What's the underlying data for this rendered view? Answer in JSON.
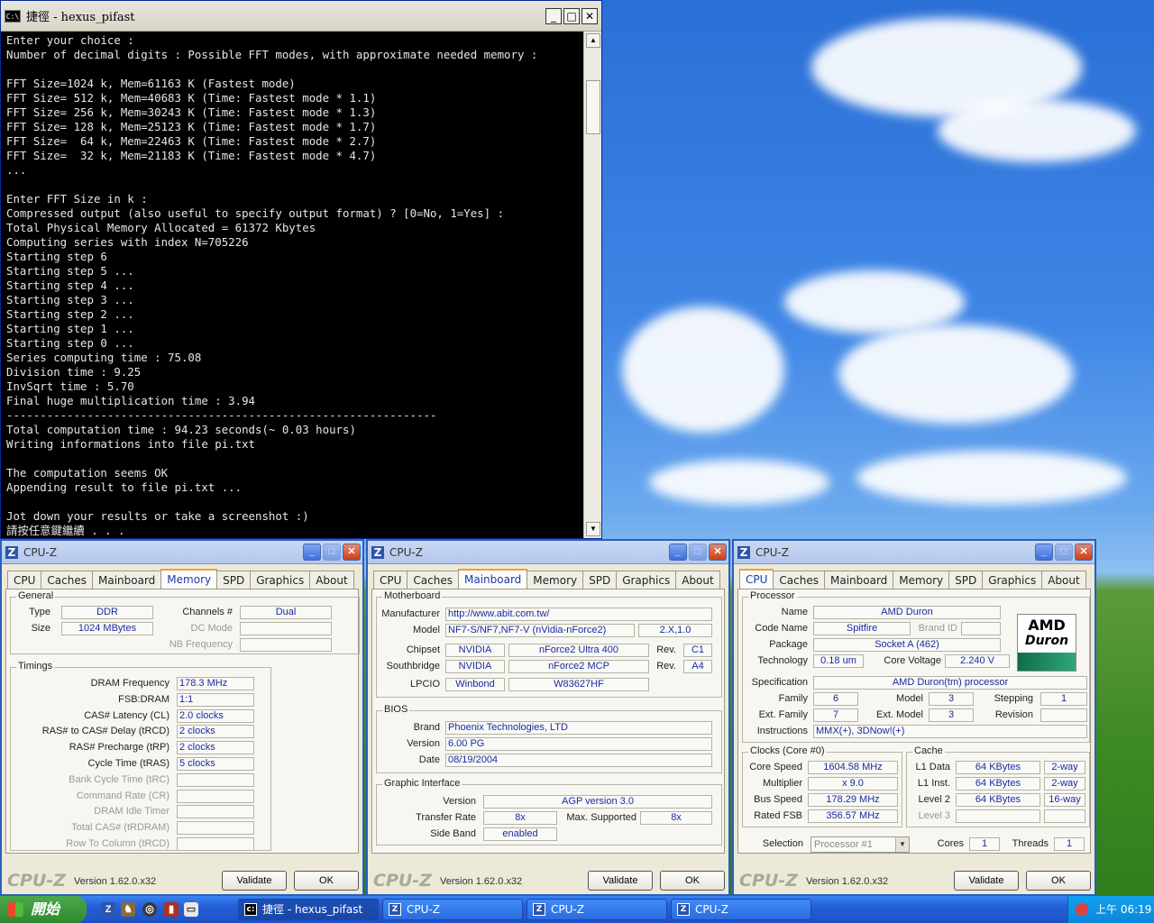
{
  "console": {
    "title": "捷徑 - hexus_pifast",
    "icon_text": "C:\\",
    "lines": [
      "Enter your choice :",
      "Number of decimal digits : Possible FFT modes, with approximate needed memory :",
      "",
      "FFT Size=1024 k, Mem=61163 K (Fastest mode)",
      "FFT Size= 512 k, Mem=40683 K (Time: Fastest mode * 1.1)",
      "FFT Size= 256 k, Mem=30243 K (Time: Fastest mode * 1.3)",
      "FFT Size= 128 k, Mem=25123 K (Time: Fastest mode * 1.7)",
      "FFT Size=  64 k, Mem=22463 K (Time: Fastest mode * 2.7)",
      "FFT Size=  32 k, Mem=21183 K (Time: Fastest mode * 4.7)",
      "...",
      "",
      "Enter FFT Size in k :",
      "Compressed output (also useful to specify output format) ? [0=No, 1=Yes] :",
      "Total Physical Memory Allocated = 61372 Kbytes",
      "Computing series with index N=705226",
      "Starting step 6",
      "Starting step 5 ...",
      "Starting step 4 ...",
      "Starting step 3 ...",
      "Starting step 2 ...",
      "Starting step 1 ...",
      "Starting step 0 ...",
      "Series computing time : 75.08",
      "Division time : 9.25",
      "InvSqrt time : 5.70",
      "Final huge multiplication time : 3.94",
      "----------------------------------------------------------------",
      "Total computation time : 94.23 seconds(~ 0.03 hours)",
      "Writing informations into file pi.txt",
      "",
      "The computation seems OK",
      "Appending result to file pi.txt ...",
      "",
      "Jot down your results or take a screenshot :)",
      "請按任意鍵繼續 . . ."
    ]
  },
  "cpuz_common": {
    "title": "CPU-Z",
    "tabs": [
      "CPU",
      "Caches",
      "Mainboard",
      "Memory",
      "SPD",
      "Graphics",
      "About"
    ],
    "logo": "CPU-Z",
    "version": "Version 1.62.0.x32",
    "validate": "Validate",
    "ok": "OK"
  },
  "memory": {
    "general_label": "General",
    "type_label": "Type",
    "type": "DDR",
    "size_label": "Size",
    "size": "1024 MBytes",
    "channels_label": "Channels #",
    "channels": "Dual",
    "dcmode_label": "DC Mode",
    "nbfreq_label": "NB Frequency",
    "timings_label": "Timings",
    "rows": [
      {
        "label": "DRAM Frequency",
        "value": "178.3 MHz",
        "enabled": true
      },
      {
        "label": "FSB:DRAM",
        "value": "1:1",
        "enabled": true
      },
      {
        "label": "CAS# Latency (CL)",
        "value": "2.0 clocks",
        "enabled": true
      },
      {
        "label": "RAS# to CAS# Delay (tRCD)",
        "value": "2 clocks",
        "enabled": true
      },
      {
        "label": "RAS# Precharge (tRP)",
        "value": "2 clocks",
        "enabled": true
      },
      {
        "label": "Cycle Time (tRAS)",
        "value": "5 clocks",
        "enabled": true
      },
      {
        "label": "Bank Cycle Time (tRC)",
        "value": "",
        "enabled": false
      },
      {
        "label": "Command Rate (CR)",
        "value": "",
        "enabled": false
      },
      {
        "label": "DRAM Idle Timer",
        "value": "",
        "enabled": false
      },
      {
        "label": "Total CAS# (tRDRAM)",
        "value": "",
        "enabled": false
      },
      {
        "label": "Row To Column (tRCD)",
        "value": "",
        "enabled": false
      }
    ]
  },
  "mainboard": {
    "motherboard_label": "Motherboard",
    "manufacturer_label": "Manufacturer",
    "manufacturer": "http://www.abit.com.tw/",
    "model_label": "Model",
    "model": "NF7-S/NF7,NF7-V (nVidia-nForce2)",
    "model_rev": "2.X,1.0",
    "chipset_label": "Chipset",
    "chipset_vendor": "NVIDIA",
    "chipset": "nForce2 Ultra 400",
    "chipset_rev_label": "Rev.",
    "chipset_rev": "C1",
    "south_label": "Southbridge",
    "south_vendor": "NVIDIA",
    "south": "nForce2 MCP",
    "south_rev_label": "Rev.",
    "south_rev": "A4",
    "lpcio_label": "LPCIO",
    "lpcio_vendor": "Winbond",
    "lpcio": "W83627HF",
    "bios_label": "BIOS",
    "brand_label": "Brand",
    "brand": "Phoenix Technologies, LTD",
    "version_label": "Version",
    "version": "6.00 PG",
    "date_label": "Date",
    "date": "08/19/2004",
    "gi_label": "Graphic Interface",
    "gi_version_label": "Version",
    "gi_version": "AGP version 3.0",
    "transfer_label": "Transfer Rate",
    "transfer": "8x",
    "maxsup_label": "Max. Supported",
    "maxsup": "8x",
    "sideband_label": "Side Band",
    "sideband": "enabled"
  },
  "cpu": {
    "processor_label": "Processor",
    "name_label": "Name",
    "name": "AMD Duron",
    "codename_label": "Code Name",
    "codename": "Spitfire",
    "brandid_label": "Brand ID",
    "package_label": "Package",
    "package": "Socket A (462)",
    "tech_label": "Technology",
    "tech": "0.18 um",
    "voltage_label": "Core Voltage",
    "voltage": "2.240 V",
    "spec_label": "Specification",
    "spec": "AMD Duron(tm) processor",
    "family_label": "Family",
    "family": "6",
    "model_label": "Model",
    "model": "3",
    "stepping_label": "Stepping",
    "stepping": "1",
    "extfamily_label": "Ext. Family",
    "extfamily": "7",
    "extmodel_label": "Ext. Model",
    "extmodel": "3",
    "revision_label": "Revision",
    "instr_label": "Instructions",
    "instr": "MMX(+), 3DNow!(+)",
    "clocks_label": "Clocks (Core #0)",
    "corespeed_label": "Core Speed",
    "corespeed": "1604.58 MHz",
    "multiplier_label": "Multiplier",
    "multiplier": "x 9.0",
    "busspeed_label": "Bus Speed",
    "busspeed": "178.29 MHz",
    "ratedfsb_label": "Rated FSB",
    "ratedfsb": "356.57 MHz",
    "cache_label": "Cache",
    "l1d_label": "L1 Data",
    "l1d": "64 KBytes",
    "l1d_way": "2-way",
    "l1i_label": "L1 Inst.",
    "l1i": "64 KBytes",
    "l1i_way": "2-way",
    "l2_label": "Level 2",
    "l2": "64 KBytes",
    "l2_way": "16-way",
    "l3_label": "Level 3",
    "selection_label": "Selection",
    "selection": "Processor #1",
    "cores_label": "Cores",
    "cores": "1",
    "threads_label": "Threads",
    "threads": "1",
    "logo_top": "AMD",
    "logo_mid": "Duron"
  },
  "taskbar": {
    "start": "開始",
    "tasks": [
      "捷徑 - hexus_pifast",
      "CPU-Z",
      "CPU-Z",
      "CPU-Z"
    ],
    "clock": "上午 06:19"
  }
}
